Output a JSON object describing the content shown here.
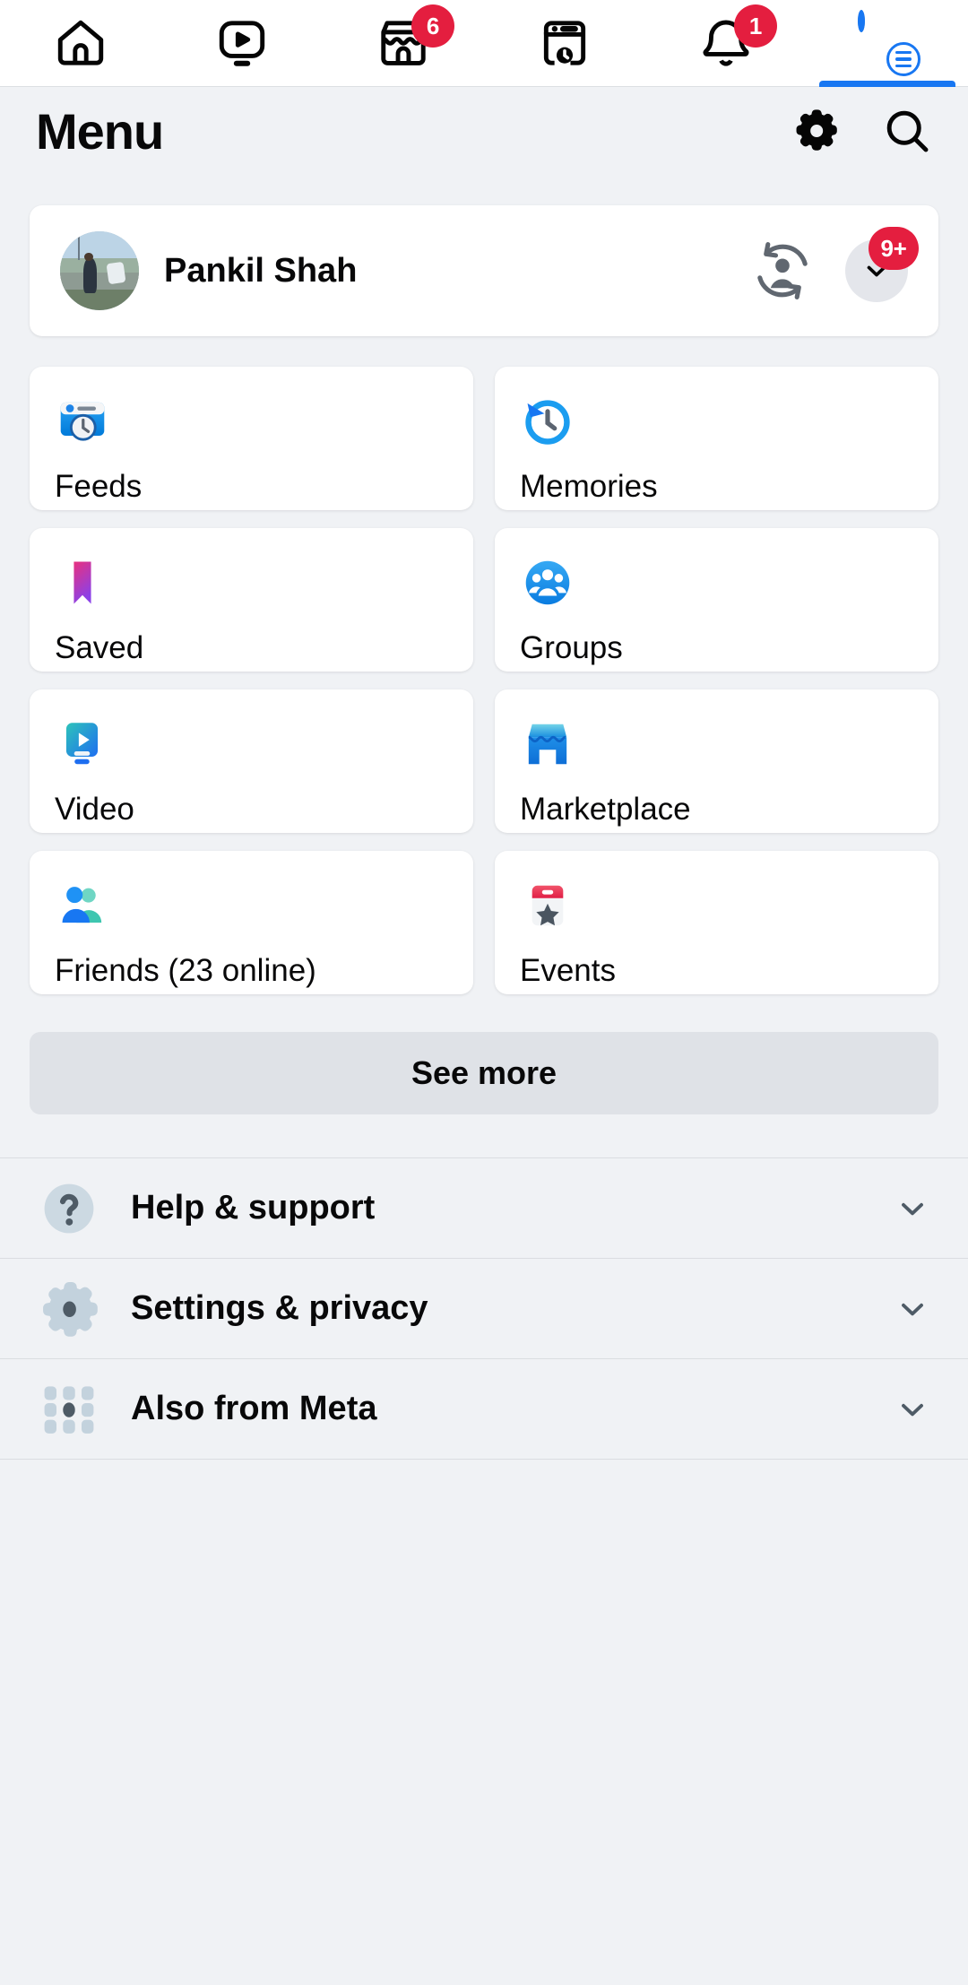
{
  "topbar": {
    "tabs": [
      {
        "name": "home",
        "icon": "home-icon",
        "badge": null,
        "active": false
      },
      {
        "name": "video",
        "icon": "video-icon",
        "badge": null,
        "active": false
      },
      {
        "name": "marketplace",
        "icon": "marketplace-icon",
        "badge": "6",
        "active": false
      },
      {
        "name": "news",
        "icon": "news-icon",
        "badge": null,
        "active": false
      },
      {
        "name": "notifications",
        "icon": "bell-icon",
        "badge": "1",
        "active": false
      },
      {
        "name": "menu-profile",
        "icon": "avatar-menu-icon",
        "badge": null,
        "active": true
      }
    ]
  },
  "header": {
    "title": "Menu",
    "settings_icon": "gear-icon",
    "search_icon": "search-icon"
  },
  "profile": {
    "name": "Pankil Shah",
    "switch_icon": "switch-account-icon",
    "expand_icon": "chevron-down-icon",
    "badge": "9+"
  },
  "tiles": [
    {
      "label": "Feeds",
      "icon": "feeds-icon"
    },
    {
      "label": "Memories",
      "icon": "memories-icon"
    },
    {
      "label": "Saved",
      "icon": "saved-bookmark-icon"
    },
    {
      "label": "Groups",
      "icon": "groups-icon"
    },
    {
      "label": "Video",
      "icon": "video-play-icon"
    },
    {
      "label": "Marketplace",
      "icon": "marketplace-store-icon"
    },
    {
      "label": "Friends (23 online)",
      "icon": "friends-icon"
    },
    {
      "label": "Events",
      "icon": "events-calendar-icon"
    }
  ],
  "see_more": {
    "label": "See more"
  },
  "list": [
    {
      "label": "Help & support",
      "icon": "question-mark-icon",
      "chevron": "chevron-down-icon"
    },
    {
      "label": "Settings & privacy",
      "icon": "gear-icon",
      "chevron": "chevron-down-icon"
    },
    {
      "label": "Also from Meta",
      "icon": "meta-apps-grid-icon",
      "chevron": "chevron-down-icon"
    }
  ],
  "colors": {
    "background": "#f0f2f5",
    "card": "#ffffff",
    "accent_blue": "#1877f2",
    "badge_red": "#e41e3f",
    "text": "#080809",
    "see_more_bg": "#dfe2e7"
  }
}
